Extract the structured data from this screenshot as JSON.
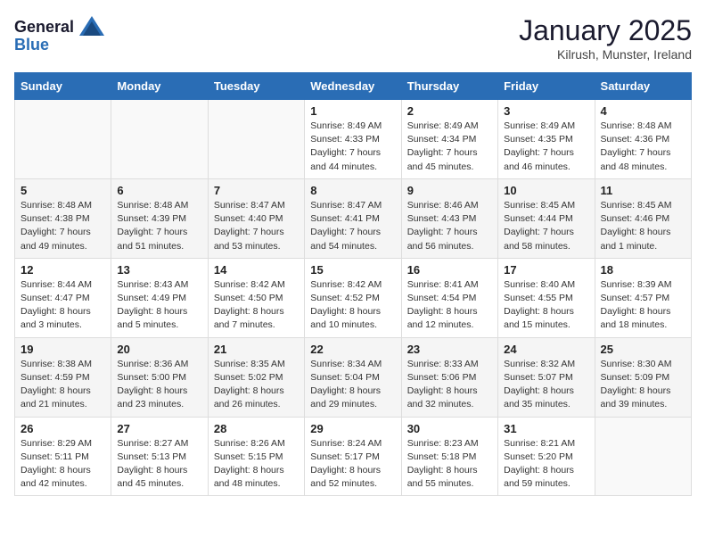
{
  "header": {
    "logo_general": "General",
    "logo_blue": "Blue",
    "month": "January 2025",
    "location": "Kilrush, Munster, Ireland"
  },
  "weekdays": [
    "Sunday",
    "Monday",
    "Tuesday",
    "Wednesday",
    "Thursday",
    "Friday",
    "Saturday"
  ],
  "weeks": [
    [
      {
        "day": "",
        "info": ""
      },
      {
        "day": "",
        "info": ""
      },
      {
        "day": "",
        "info": ""
      },
      {
        "day": "1",
        "info": "Sunrise: 8:49 AM\nSunset: 4:33 PM\nDaylight: 7 hours\nand 44 minutes."
      },
      {
        "day": "2",
        "info": "Sunrise: 8:49 AM\nSunset: 4:34 PM\nDaylight: 7 hours\nand 45 minutes."
      },
      {
        "day": "3",
        "info": "Sunrise: 8:49 AM\nSunset: 4:35 PM\nDaylight: 7 hours\nand 46 minutes."
      },
      {
        "day": "4",
        "info": "Sunrise: 8:48 AM\nSunset: 4:36 PM\nDaylight: 7 hours\nand 48 minutes."
      }
    ],
    [
      {
        "day": "5",
        "info": "Sunrise: 8:48 AM\nSunset: 4:38 PM\nDaylight: 7 hours\nand 49 minutes."
      },
      {
        "day": "6",
        "info": "Sunrise: 8:48 AM\nSunset: 4:39 PM\nDaylight: 7 hours\nand 51 minutes."
      },
      {
        "day": "7",
        "info": "Sunrise: 8:47 AM\nSunset: 4:40 PM\nDaylight: 7 hours\nand 53 minutes."
      },
      {
        "day": "8",
        "info": "Sunrise: 8:47 AM\nSunset: 4:41 PM\nDaylight: 7 hours\nand 54 minutes."
      },
      {
        "day": "9",
        "info": "Sunrise: 8:46 AM\nSunset: 4:43 PM\nDaylight: 7 hours\nand 56 minutes."
      },
      {
        "day": "10",
        "info": "Sunrise: 8:45 AM\nSunset: 4:44 PM\nDaylight: 7 hours\nand 58 minutes."
      },
      {
        "day": "11",
        "info": "Sunrise: 8:45 AM\nSunset: 4:46 PM\nDaylight: 8 hours\nand 1 minute."
      }
    ],
    [
      {
        "day": "12",
        "info": "Sunrise: 8:44 AM\nSunset: 4:47 PM\nDaylight: 8 hours\nand 3 minutes."
      },
      {
        "day": "13",
        "info": "Sunrise: 8:43 AM\nSunset: 4:49 PM\nDaylight: 8 hours\nand 5 minutes."
      },
      {
        "day": "14",
        "info": "Sunrise: 8:42 AM\nSunset: 4:50 PM\nDaylight: 8 hours\nand 7 minutes."
      },
      {
        "day": "15",
        "info": "Sunrise: 8:42 AM\nSunset: 4:52 PM\nDaylight: 8 hours\nand 10 minutes."
      },
      {
        "day": "16",
        "info": "Sunrise: 8:41 AM\nSunset: 4:54 PM\nDaylight: 8 hours\nand 12 minutes."
      },
      {
        "day": "17",
        "info": "Sunrise: 8:40 AM\nSunset: 4:55 PM\nDaylight: 8 hours\nand 15 minutes."
      },
      {
        "day": "18",
        "info": "Sunrise: 8:39 AM\nSunset: 4:57 PM\nDaylight: 8 hours\nand 18 minutes."
      }
    ],
    [
      {
        "day": "19",
        "info": "Sunrise: 8:38 AM\nSunset: 4:59 PM\nDaylight: 8 hours\nand 21 minutes."
      },
      {
        "day": "20",
        "info": "Sunrise: 8:36 AM\nSunset: 5:00 PM\nDaylight: 8 hours\nand 23 minutes."
      },
      {
        "day": "21",
        "info": "Sunrise: 8:35 AM\nSunset: 5:02 PM\nDaylight: 8 hours\nand 26 minutes."
      },
      {
        "day": "22",
        "info": "Sunrise: 8:34 AM\nSunset: 5:04 PM\nDaylight: 8 hours\nand 29 minutes."
      },
      {
        "day": "23",
        "info": "Sunrise: 8:33 AM\nSunset: 5:06 PM\nDaylight: 8 hours\nand 32 minutes."
      },
      {
        "day": "24",
        "info": "Sunrise: 8:32 AM\nSunset: 5:07 PM\nDaylight: 8 hours\nand 35 minutes."
      },
      {
        "day": "25",
        "info": "Sunrise: 8:30 AM\nSunset: 5:09 PM\nDaylight: 8 hours\nand 39 minutes."
      }
    ],
    [
      {
        "day": "26",
        "info": "Sunrise: 8:29 AM\nSunset: 5:11 PM\nDaylight: 8 hours\nand 42 minutes."
      },
      {
        "day": "27",
        "info": "Sunrise: 8:27 AM\nSunset: 5:13 PM\nDaylight: 8 hours\nand 45 minutes."
      },
      {
        "day": "28",
        "info": "Sunrise: 8:26 AM\nSunset: 5:15 PM\nDaylight: 8 hours\nand 48 minutes."
      },
      {
        "day": "29",
        "info": "Sunrise: 8:24 AM\nSunset: 5:17 PM\nDaylight: 8 hours\nand 52 minutes."
      },
      {
        "day": "30",
        "info": "Sunrise: 8:23 AM\nSunset: 5:18 PM\nDaylight: 8 hours\nand 55 minutes."
      },
      {
        "day": "31",
        "info": "Sunrise: 8:21 AM\nSunset: 5:20 PM\nDaylight: 8 hours\nand 59 minutes."
      },
      {
        "day": "",
        "info": ""
      }
    ]
  ]
}
